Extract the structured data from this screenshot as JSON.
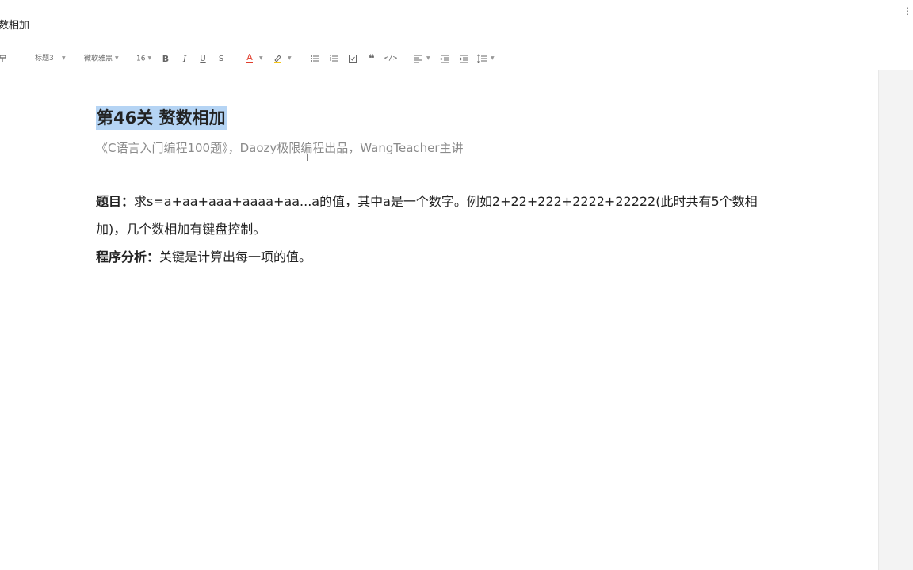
{
  "window": {
    "doc_title": "数相加",
    "more_icon": "more-vertical-icon"
  },
  "toolbar": {
    "format_painter_icon": "format-painter-icon",
    "heading_style": "标题3",
    "font_family": "微软雅黑",
    "font_size": "16",
    "bold_icon": "bold-icon",
    "italic_icon": "italic-icon",
    "underline_icon": "underline-icon",
    "strike_icon": "strikethrough-icon",
    "font_color_icon": "font-color-icon",
    "font_color": "#e03e2d",
    "highlight_icon": "highlight-icon",
    "highlight_color": "#f5c518",
    "bullet_list_icon": "bullet-list-icon",
    "ordered_list_icon": "ordered-list-icon",
    "task_list_icon": "task-list-icon",
    "quote_icon": "quote-icon",
    "code_icon": "code-icon",
    "align_icon": "align-left-icon",
    "indent_icon": "indent-icon",
    "outdent_icon": "outdent-icon",
    "line_height_icon": "line-height-icon"
  },
  "document": {
    "heading": "第46关 赘数相加",
    "subtitle": "《C语言入门编程100题》，Daozy极限编程出品，WangTeacher主讲",
    "problem_label": "题目：",
    "problem_text_line1": "求s=a+aa+aaa+aaaa+aa...a的值，其中a是一个数字。例如2+22+222+2222+22222(此时共有5个数相",
    "problem_text_line2": "加)，几个数相加有键盘控制。",
    "analysis_label": "程序分析：",
    "analysis_text": "关键是计算出每一项的值。"
  },
  "colors": {
    "selection": "#b5d4f4",
    "subtitle": "#8a8a8a",
    "gutter": "#f3f3f3"
  }
}
